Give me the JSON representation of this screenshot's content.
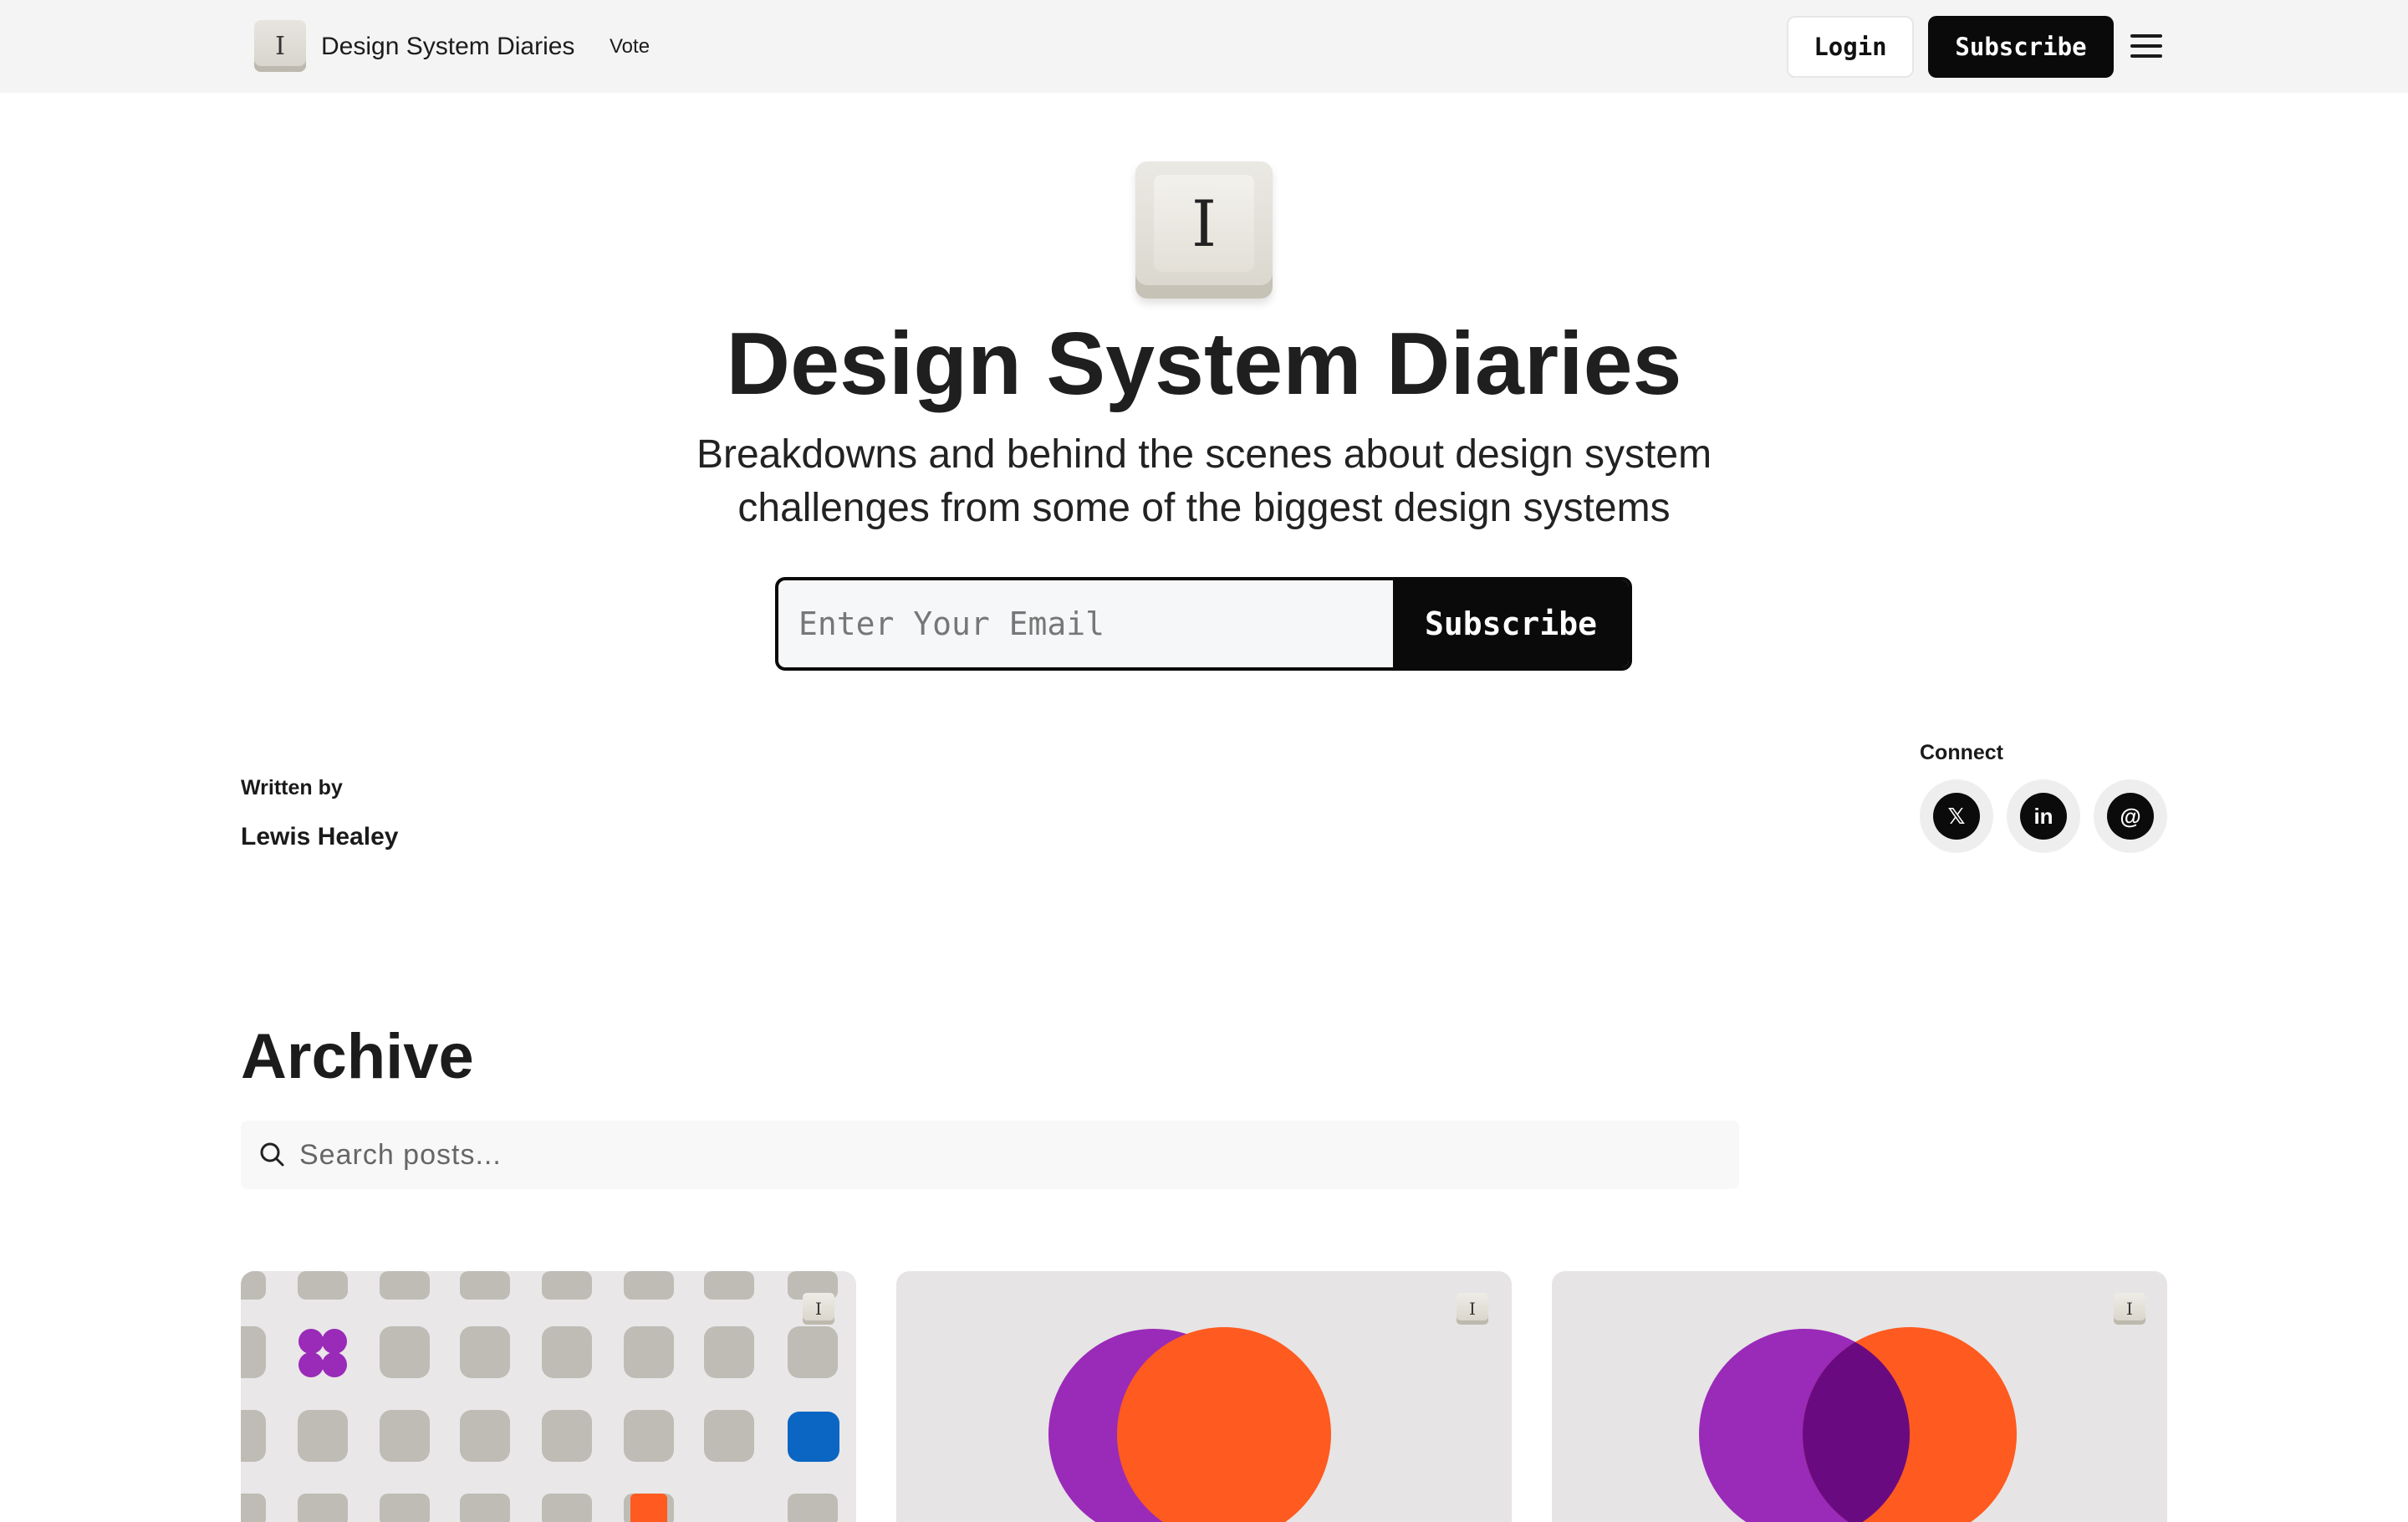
{
  "nav": {
    "logo_glyph": "I",
    "title": "Design System Diaries",
    "vote": "Vote",
    "login": "Login",
    "subscribe": "Subscribe",
    "menu_icon": "hamburger-icon"
  },
  "hero": {
    "key_glyph": "I",
    "title": "Design System Diaries",
    "subtitle": "Breakdowns and behind the scenes about design system challenges from some of the biggest design systems",
    "email_placeholder": "Enter Your Email",
    "subscribe": "Subscribe"
  },
  "author": {
    "written_by": "Written by",
    "name": "Lewis Healey"
  },
  "connect": {
    "label": "Connect",
    "links": [
      {
        "icon": "x-icon",
        "glyph": "𝕏"
      },
      {
        "icon": "linkedin-icon",
        "glyph": "in"
      },
      {
        "icon": "threads-icon",
        "glyph": "@"
      }
    ]
  },
  "archive": {
    "title": "Archive",
    "search_placeholder": "Search posts..."
  },
  "cards": [
    {
      "badge": "I",
      "art": "pattern"
    },
    {
      "badge": "I",
      "art": "overlap-circles"
    },
    {
      "badge": "I",
      "art": "venn-circles"
    }
  ],
  "colors": {
    "purple": "#9a2ab8",
    "orange": "#ff5a1f",
    "blue": "#0a66c2",
    "overlap": "#6a0a80"
  }
}
